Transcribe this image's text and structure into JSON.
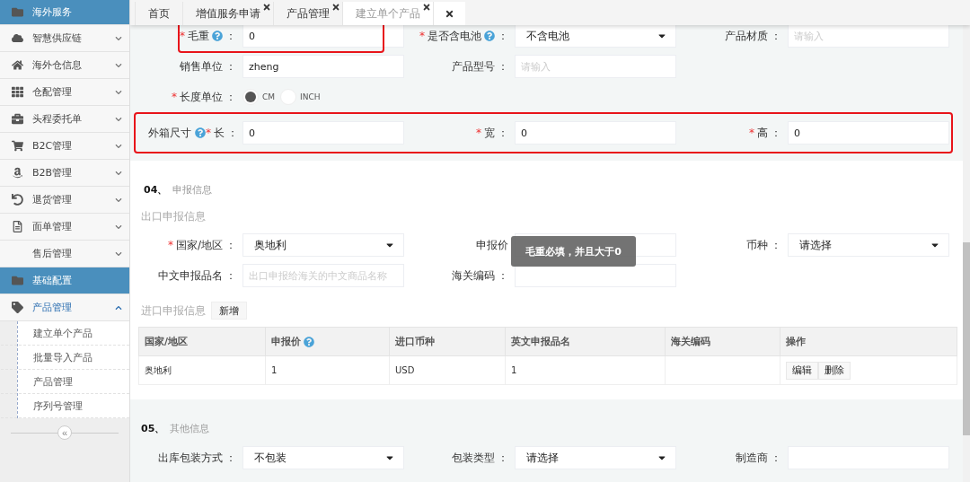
{
  "sidebar": {
    "items": [
      {
        "label": "海外服务",
        "kind": "header"
      },
      {
        "label": "智慧供应链",
        "kind": "menu",
        "expanded": false
      },
      {
        "label": "海外仓信息",
        "kind": "menu",
        "expanded": false
      },
      {
        "label": "仓配管理",
        "kind": "menu",
        "expanded": false
      },
      {
        "label": "头程委托单",
        "kind": "menu",
        "expanded": false
      },
      {
        "label": "B2C管理",
        "kind": "menu",
        "expanded": false
      },
      {
        "label": "B2B管理",
        "kind": "menu",
        "expanded": false
      },
      {
        "label": "退货管理",
        "kind": "menu",
        "expanded": false
      },
      {
        "label": "面单管理",
        "kind": "menu",
        "expanded": false
      },
      {
        "label": "售后管理",
        "kind": "menu",
        "expanded": false
      },
      {
        "label": "基础配置",
        "kind": "header"
      },
      {
        "label": "产品管理",
        "kind": "menu",
        "expanded": true,
        "children": [
          {
            "label": "建立单个产品"
          },
          {
            "label": "批量导入产品"
          },
          {
            "label": "产品管理"
          },
          {
            "label": "序列号管理"
          }
        ]
      }
    ],
    "collapse_label": "«"
  },
  "tabs": [
    {
      "kind": "tab",
      "label": "首页",
      "selected": false,
      "closable": false
    },
    {
      "kind": "tab",
      "label": "增值服务申请",
      "selected": false,
      "closable": true
    },
    {
      "kind": "tab",
      "label": "产品管理",
      "selected": false,
      "closable": true
    },
    {
      "kind": "tab",
      "label": "建立单个产品",
      "selected": true,
      "closable": true
    },
    {
      "kind": "close-all"
    }
  ],
  "basic_form": {
    "rows": [
      {
        "fields": [
          {
            "mark": "*",
            "label": "毛重",
            "help": true,
            "colon": "：",
            "kind": "input",
            "value": "0",
            "highlighted": true
          },
          {
            "mark": "*",
            "label": "是否含电池",
            "help": true,
            "colon": "：",
            "kind": "select",
            "value": "不含电池"
          },
          {
            "label": "产品材质",
            "colon": "：",
            "kind": "input",
            "placeholder": "请输入"
          }
        ]
      },
      {
        "fields": [
          {
            "label": "销售单位",
            "colon": "：",
            "kind": "input",
            "value": "zheng"
          },
          {
            "label": "产品型号",
            "colon": "：",
            "kind": "input",
            "placeholder": "请输入"
          }
        ]
      },
      {
        "fields": [
          {
            "mark": "*",
            "label": "长度单位",
            "colon": "：",
            "kind": "radio",
            "options": [
              {
                "label": "CM",
                "selected": true
              },
              {
                "label": "INCH",
                "selected": false
              }
            ]
          }
        ]
      },
      {
        "group_label": "外箱尺寸",
        "group_help": true,
        "highlighted": true,
        "fields": [
          {
            "mark": "*",
            "label": "长",
            "colon": "：",
            "kind": "input",
            "value": "0"
          },
          {
            "mark": "*",
            "label": "宽",
            "colon": "：",
            "kind": "input",
            "value": "0"
          },
          {
            "mark": "*",
            "label": "高",
            "colon": "：",
            "kind": "input",
            "value": "0"
          }
        ]
      }
    ]
  },
  "declaration": {
    "number": "04、",
    "title": "申报信息",
    "export": {
      "title": "出口申报信息",
      "rows": [
        {
          "fields": [
            {
              "mark": "*",
              "label": "国家/地区",
              "colon": "：",
              "kind": "select",
              "value": "奥地利"
            },
            {
              "label": "申报价",
              "kind": "input"
            },
            {
              "label": "币种",
              "colon": "：",
              "kind": "select",
              "value": "请选择"
            }
          ]
        },
        {
          "fields": [
            {
              "label": "中文申报品名",
              "colon": "：",
              "kind": "input",
              "placeholder": "出口申报给海关的中文商品名称"
            },
            {
              "label": "海关编码",
              "colon": "：",
              "kind": "input"
            }
          ]
        }
      ]
    },
    "import": {
      "title": "进口申报信息",
      "add_button": "新增",
      "columns": [
        {
          "label": "国家/地区",
          "help": false
        },
        {
          "label": "申报价",
          "help": true
        },
        {
          "label": "进口币种",
          "help": false
        },
        {
          "label": "英文申报品名",
          "help": false
        },
        {
          "label": "海关编码",
          "help": false
        },
        {
          "label": "操作",
          "help": false
        }
      ],
      "rows": [
        {
          "cells": [
            "奥地利",
            "1",
            "USD",
            "1",
            ""
          ],
          "actions": [
            "编辑",
            "删除"
          ]
        }
      ]
    }
  },
  "toast": "毛重必填，并且大于0",
  "other": {
    "number": "05、",
    "title": "其他信息",
    "rows": [
      {
        "fields": [
          {
            "label": "出库包装方式",
            "colon": "：",
            "kind": "select",
            "value": "不包装"
          },
          {
            "label": "包装类型",
            "colon": "：",
            "kind": "select",
            "value": "请选择"
          },
          {
            "label": "制造商",
            "colon": "：",
            "kind": "input"
          }
        ]
      }
    ]
  }
}
